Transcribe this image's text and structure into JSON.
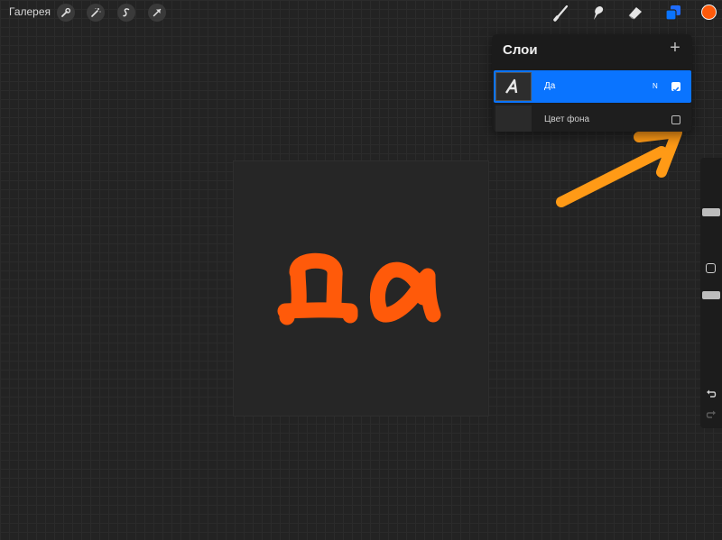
{
  "topbar": {
    "gallery_label": "Галерея",
    "left_tools": [
      "wrench-icon",
      "magic-wand-icon",
      "selection-icon",
      "transform-arrow-icon"
    ],
    "right_tools": [
      "brush-icon",
      "smudge-icon",
      "eraser-icon",
      "layers-icon"
    ],
    "active_color": "#ff5a0a"
  },
  "layers_panel": {
    "title": "Слои",
    "add_icon": "+",
    "layers": [
      {
        "name": "Да",
        "mode": "N",
        "visible": true,
        "selected": true
      },
      {
        "name": "Цвет фона",
        "mode": "",
        "visible": false,
        "selected": false
      }
    ]
  },
  "sidebar": {
    "size_slider": 0.2,
    "opacity_slider": 0.8,
    "undo_icon": "undo-icon",
    "redo_icon": "redo-icon"
  },
  "colors": {
    "accent": "#0a74ff",
    "paint": "#ff5a0a",
    "annotation_arrow": "#ff9a16"
  }
}
